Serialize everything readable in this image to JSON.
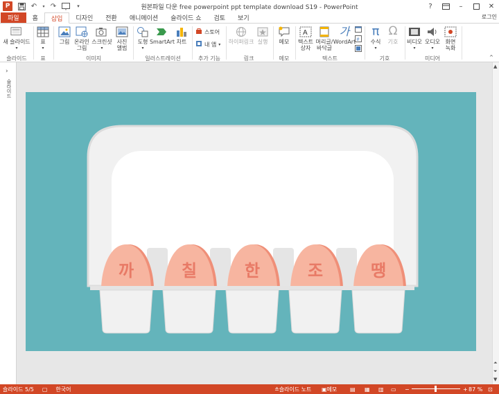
{
  "window": {
    "title": "원본파일 다운 free powerpoint ppt template download S19 - PowerPoint",
    "app_icon": "P",
    "help": "?",
    "signin": "로그인"
  },
  "tabs": [
    "파일",
    "홈",
    "삽입",
    "디자인",
    "전환",
    "애니메이션",
    "슬라이드 쇼",
    "검토",
    "보기"
  ],
  "active_tab": "삽입",
  "ribbon": {
    "new_slide": "새 슬라이드",
    "table": "표",
    "picture": "그림",
    "online_picture": "온라인\n그림",
    "screenshot": "스크린샷",
    "photo_album": "사진\n앨범",
    "shapes": "도형",
    "smartart": "SmartArt",
    "chart": "차트",
    "store": "스토어",
    "my_apps": "내 앱",
    "hyperlink": "하이퍼링크",
    "action": "실행",
    "comment": "메모",
    "textbox": "텍스트\n상자",
    "header_footer": "머리글/\n바닥글",
    "wordart": "WordArt",
    "equation": "수식",
    "symbol": "기호",
    "video": "비디오",
    "audio": "오디오",
    "screen_recording": "화면\n녹화",
    "groups": {
      "slides": "슬라이드",
      "tables": "표",
      "images": "이미지",
      "illustrations": "일러스트레이션",
      "addins": "추가 기능",
      "links": "링크",
      "comments": "메모",
      "text": "텍스트",
      "symbols": "기호",
      "media": "미디어"
    }
  },
  "leftpane": {
    "label": "슬라이드"
  },
  "slide": {
    "eggs": [
      "까",
      "칠",
      "한",
      "조",
      "땡"
    ],
    "colors": {
      "background": "#64b4bb",
      "egg": "#f7b5a0",
      "egg_shade": "#ef8f78",
      "egg_text": "#e87a66",
      "carton": "#f1f1f1",
      "carton_shadow": "#d9d9d9"
    }
  },
  "status": {
    "slide_count": "슬라이드 5/5",
    "language": "한국어",
    "notes": "슬라이드 노트",
    "comments": "메모",
    "zoom": "87 %",
    "zoom_level": 0.87
  },
  "colors": {
    "accent": "#d24726"
  }
}
